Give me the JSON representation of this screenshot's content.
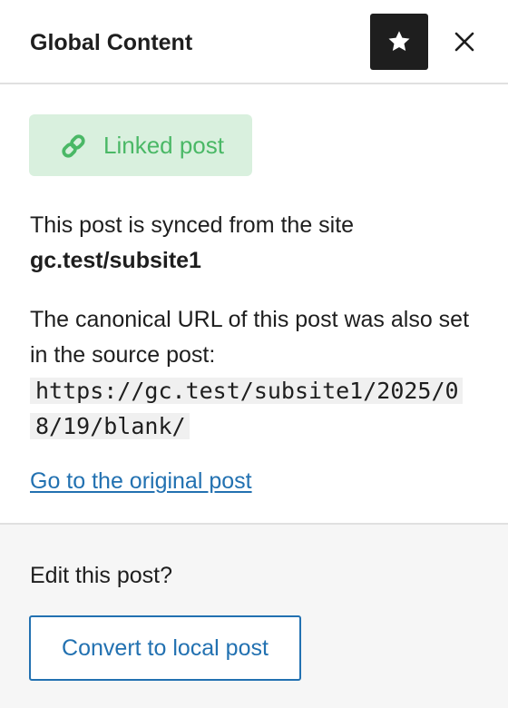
{
  "header": {
    "title": "Global Content",
    "pin_icon": "star-icon",
    "close_icon": "close-icon"
  },
  "badge": {
    "label": "Linked post",
    "icon": "link-icon",
    "background_color": "#d9f0de",
    "text_color": "#4ab866"
  },
  "sync_info": {
    "text": "This post is synced from the site",
    "site": "gc.test/subsite1"
  },
  "canonical": {
    "text": "The canonical URL of this post was also set in the source post:",
    "url": "https://gc.test/subsite1/2025/08/19/blank/"
  },
  "original_link": {
    "label": "Go to the original post"
  },
  "footer": {
    "question": "Edit this post?",
    "button_label": "Convert to local post"
  },
  "colors": {
    "accent": "#2271b1",
    "dark": "#1e1e1e",
    "footer_bg": "#f6f6f6"
  }
}
